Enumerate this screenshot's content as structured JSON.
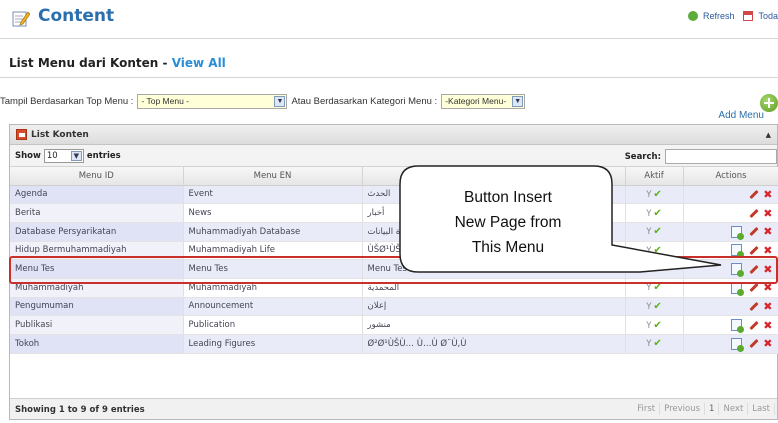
{
  "header": {
    "title": "Content",
    "icon": "edit-pencil-icon",
    "refresh_label": "Refresh",
    "today_label": "Toda"
  },
  "list_title": {
    "main": "List Menu dari Konten - ",
    "link": "View All"
  },
  "filters": {
    "top_menu_label": "Tampil Berdasarkan Top Menu :",
    "top_menu_value": "- Top Menu -",
    "kategori_label": "Atau Berdasarkan Kategori Menu :",
    "kategori_value": "-Kategori Menu-",
    "add_menu_label": "Add Menu"
  },
  "panel": {
    "title": "List Konten",
    "show_label": "Show",
    "show_value": "10",
    "entries_label": "entries",
    "search_label": "Search:"
  },
  "columns": [
    "Menu ID",
    "Menu EN",
    "",
    "Aktif",
    "Actions"
  ],
  "rows": [
    {
      "id": "Agenda",
      "en": "Event",
      "ar": "الحدث",
      "aktif": "Y",
      "insert": false
    },
    {
      "id": "Berita",
      "en": "News",
      "ar": "أخبار",
      "aktif": "Y",
      "insert": false
    },
    {
      "id": "Database Persyarikatan",
      "en": "Muhammadiyah Database",
      "ar": "قاعدة البيانات",
      "aktif": "Y",
      "insert": true
    },
    {
      "id": "Hidup Bermuhammadiyah",
      "en": "Muhammadiyah Life",
      "ar": "ÙŠØ¹ÙŠØ´",
      "aktif": "Y",
      "insert": true
    },
    {
      "id": "Menu Tes",
      "en": "Menu Tes",
      "ar": "Menu Tes",
      "aktif": "Y",
      "insert": true
    },
    {
      "id": "Muhammadiyah",
      "en": "Muhammadiyah",
      "ar": "المحمدية",
      "aktif": "Y",
      "insert": true
    },
    {
      "id": "Pengumuman",
      "en": "Announcement",
      "ar": "إعلان",
      "aktif": "Y",
      "insert": false
    },
    {
      "id": "Publikasi",
      "en": "Publication",
      "ar": "منشور",
      "aktif": "Y",
      "insert": true
    },
    {
      "id": "Tokoh",
      "en": "Leading Figures",
      "ar": "Ø²Ø¹ÙŠÙ… Ù…Ù Ø¨Ù‚Ù",
      "aktif": "Y",
      "insert": true
    }
  ],
  "footer": {
    "info": "Showing 1 to 9 of 9 entries",
    "pager": [
      "First",
      "Previous",
      "1",
      "Next",
      "Last"
    ]
  },
  "callout": {
    "line1": "Button Insert",
    "line2": "New Page from",
    "line3": "This Menu"
  },
  "colors": {
    "accent": "#2b6fad",
    "highlight": "#c9302c",
    "active_check": "#59b21c",
    "delete": "#d8262d"
  }
}
